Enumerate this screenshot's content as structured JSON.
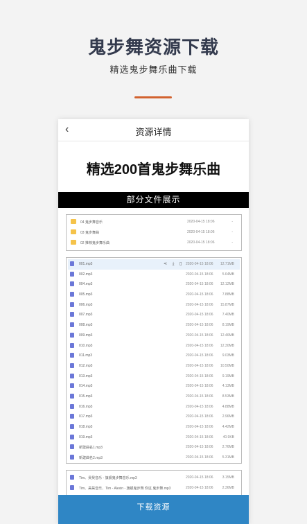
{
  "hero": {
    "title": "鬼步舞资源下载",
    "subtitle": "精选鬼步舞乐曲下载"
  },
  "nav": {
    "back_icon": "chevron-left-icon",
    "back_glyph": "‹",
    "title": "资源详情"
  },
  "main": {
    "title": "精选200首鬼步舞乐曲",
    "banner": "部分文件展示"
  },
  "folders": [
    {
      "name": "04 鬼步舞音乐",
      "date": "2020-04-15 18:06",
      "size": "-"
    },
    {
      "name": "03 鬼步舞曲",
      "date": "2020-04-15 18:06",
      "size": "-"
    },
    {
      "name": "02 推荐鬼步舞乐曲",
      "date": "2020-04-15 18:06",
      "size": "-"
    }
  ],
  "files": [
    {
      "name": "001.mp3",
      "date": "2020-04-15 18:06",
      "size": "12.71MB",
      "actions": "⋖ ⤓ ▯"
    },
    {
      "name": "002.mp3",
      "date": "2020-04-15 18:06",
      "size": "5.64MB"
    },
    {
      "name": "004.mp3",
      "date": "2020-04-15 18:06",
      "size": "12.12MB"
    },
    {
      "name": "005.mp3",
      "date": "2020-04-15 18:06",
      "size": "7.88MB"
    },
    {
      "name": "006.mp3",
      "date": "2020-04-15 18:06",
      "size": "15.87MB"
    },
    {
      "name": "007.mp3",
      "date": "2020-04-15 18:06",
      "size": "7.40MB"
    },
    {
      "name": "008.mp3",
      "date": "2020-04-15 18:06",
      "size": "8.19MB"
    },
    {
      "name": "009.mp3",
      "date": "2020-04-15 18:06",
      "size": "12.46MB"
    },
    {
      "name": "010.mp3",
      "date": "2020-04-15 18:06",
      "size": "12.30MB"
    },
    {
      "name": "011.mp3",
      "date": "2020-04-15 18:06",
      "size": "9.03MB"
    },
    {
      "name": "012.mp3",
      "date": "2020-04-15 18:06",
      "size": "10.50MB"
    },
    {
      "name": "013.mp3",
      "date": "2020-04-15 18:06",
      "size": "9.19MB"
    },
    {
      "name": "014.mp3",
      "date": "2020-04-15 18:06",
      "size": "4.13MB"
    },
    {
      "name": "015.mp3",
      "date": "2020-04-15 18:06",
      "size": "8.53MB"
    },
    {
      "name": "016.mp3",
      "date": "2020-04-15 18:06",
      "size": "4.88MB"
    },
    {
      "name": "017.mp3",
      "date": "2020-04-15 18:06",
      "size": "2.96MB"
    },
    {
      "name": "018.mp3",
      "date": "2020-04-15 18:06",
      "size": "4.42MB"
    },
    {
      "name": "019.mp3",
      "date": "2020-04-15 18:06",
      "size": "40.9KB"
    },
    {
      "name": "新建曲名1.mp3",
      "date": "2020-04-15 18:06",
      "size": "2.76MB"
    },
    {
      "name": "新建曲名2.mp3",
      "date": "2020-04-15 18:06",
      "size": "5.31MB"
    }
  ],
  "files2": [
    {
      "name": "Tim、昊昊音乐 - 旗舰鬼步舞音乐.mp3",
      "date": "2020-04-15 18:06",
      "size": "3.15MB"
    },
    {
      "name": "Tim、昊昊音乐、Tim - Alexin - 旗舰鬼步舞 你这 鬼步舞.mp3",
      "date": "2020-04-15 18:06",
      "size": "2.36MB"
    }
  ],
  "download_button": "下载资源",
  "colors": {
    "accent": "#d2622f",
    "button": "#2f86c5",
    "folder": "#f5c34a",
    "file_icon": "#6b77d8"
  }
}
